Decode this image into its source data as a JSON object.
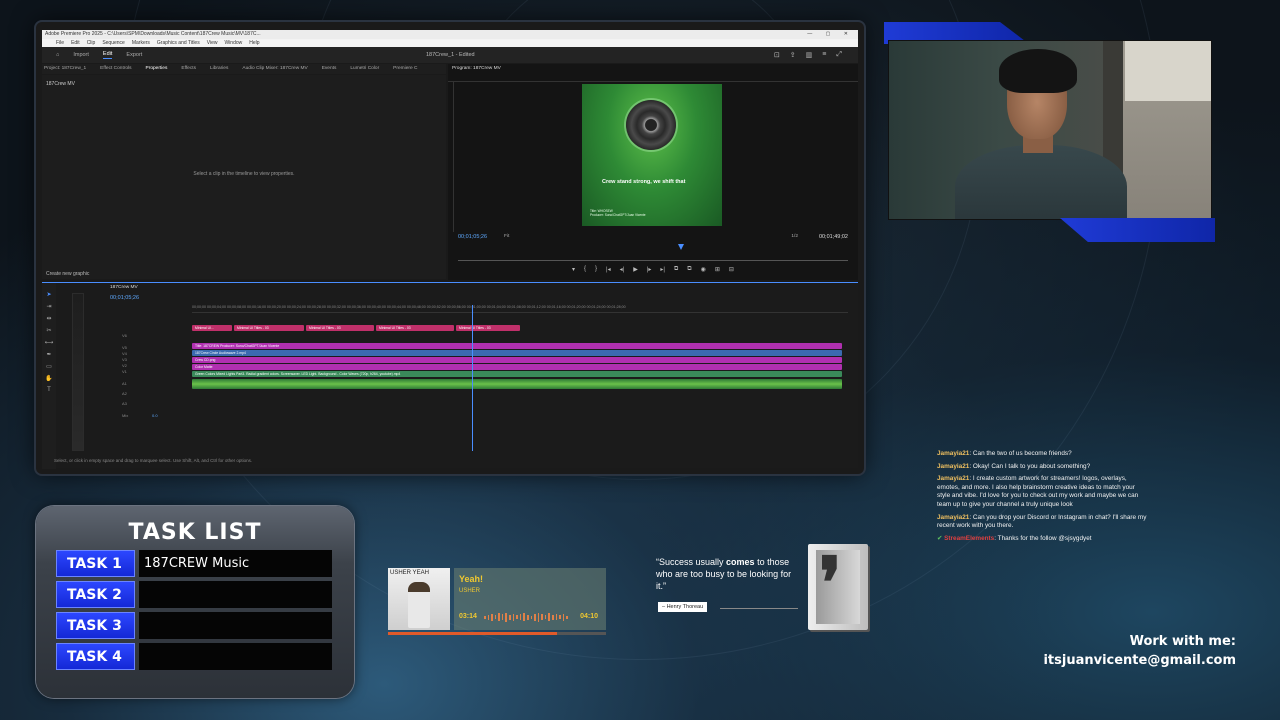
{
  "premiere": {
    "window_title": "Adobe Premiere Pro 2025 - C:\\Users\\SPM\\Downloads\\Music Content\\187Crew Music\\MV\\187C...",
    "window_controls": "— ▢ ✕",
    "menu": [
      "File",
      "Edit",
      "Clip",
      "Sequence",
      "Markers",
      "Graphics and Titles",
      "View",
      "Window",
      "Help"
    ],
    "header_tabs": [
      "Import",
      "Edit",
      "Export"
    ],
    "document_title": "187Crew_1 - Edited",
    "panel_tabs": [
      "Project: 187Crew_1",
      "Effect Controls",
      "Properties",
      "Effects",
      "Libraries",
      "Audio Clip Mixer: 187Crew MV",
      "Events",
      "Lumetri Color",
      "Premiere C"
    ],
    "sequence_name": "187Crew MV",
    "properties_hint": "Select a clip in the timeline to view properties.",
    "create_graphic": "Create new graphic",
    "program_tab": "Program: 187Crew MV",
    "frame_lyric": "Crew stand strong, we shift that",
    "frame_credits_1": "Title: WHOSEW",
    "frame_credits_2": "Producer: Suno/ChatGPT/Juan Vicente",
    "program_timecode": "00;01;05;26",
    "fit": "Fit",
    "quality": "1/2",
    "duration": "00;01;49;02",
    "transport": [
      "▾",
      "{",
      "}",
      "|◂",
      "◂|",
      "▶",
      "|▸",
      "▸|",
      "⧉",
      "⧉",
      "◉",
      "⊞",
      "⊟"
    ],
    "timeline_tab": "187Crew MV",
    "timeline_timecode": "00;01;05;26",
    "ruler_text": "00;00;00 00;00;04;00 00;00;08;00 00;00;16;00 00;00;20;00 00;00;24;00 00;00;28;00 00;00;32;00 00;00;36;00 00;00;40;00 00;00;44;00 00;00;48;00 00;00;52;00 00;00;56;00 00;01;00;00 00;01;04;00 00;01;08;00 00;01;12;00 00;01;16;00 00;01;20;00 00;01;24;00 00;01;28;00",
    "clips": [
      {
        "label": "Minimal UI...",
        "color": "#c0306a"
      },
      {
        "label": "Minimal UI Titles - 03",
        "color": "#c0306a"
      },
      {
        "label": "Minimal UI Titles - 03",
        "color": "#c0306a"
      },
      {
        "label": "Minimal UI Titles - 03",
        "color": "#c0306a"
      },
      {
        "label": "Minimal UI Titles - 03",
        "color": "#c0306a"
      },
      {
        "label": "Title: 187CREW Producer: Suno/ChatGPT/Juan Vicente",
        "color": "#b030b0"
      },
      {
        "label": "187Crew Circle Audiowave 2.mp4",
        "color": "#3a6ab0"
      },
      {
        "label": "Crew CD.png",
        "color": "#b030b0"
      },
      {
        "label": "Color Matte",
        "color": "#b030b0"
      },
      {
        "label": "Green Colors Mixed Lights Part3. Radial gradient colors. Screensaver. LED Light. Background - Color Waves (720p, h264, youtube).mp4",
        "color": "#3a8a5a"
      }
    ],
    "track_labels": [
      "V6",
      "V5",
      "V4",
      "V3",
      "V2",
      "V1",
      "A1",
      "A2",
      "A3",
      "Mix"
    ],
    "mix_value": "0.0",
    "status_text": "Select, or click in empty space and drag to marquee select. Use Shift, Alt, and Ctrl for other options."
  },
  "chat": [
    {
      "user": "Jamayia21",
      "text": "Can the two of us become friends?"
    },
    {
      "user": "Jamayia21",
      "text": "Okay! Can I talk to you about something?"
    },
    {
      "user": "Jamayia21",
      "text": "I create custom artwork for streamers! logos, overlays, emotes, and more. I also help brainstorm creative ideas to match your style and vibe. I'd love for you to check out my work and maybe we can team up to give your channel a truly unique look"
    },
    {
      "user": "Jamayia21",
      "text": "Can you drop your Discord or Instagram in chat? I'll share my recent work with you there."
    },
    {
      "user": "StreamElements",
      "text": "Thanks for the follow @sjsygdyet"
    }
  ],
  "task_list": {
    "title": "TASK LIST",
    "tasks": [
      {
        "label": "TASK 1",
        "value": "187CREW Music"
      },
      {
        "label": "TASK 2",
        "value": ""
      },
      {
        "label": "TASK 3",
        "value": ""
      },
      {
        "label": "TASK 4",
        "value": ""
      }
    ]
  },
  "music": {
    "album_text": "USHER YEAH",
    "title": "Yeah!",
    "artist": "USHER",
    "current_time": "03:14",
    "total_time": "04:10",
    "progress": 0.775
  },
  "quote": {
    "text_lead": "“Success usually ",
    "text_bold": "comes",
    "text_rest": " to those who are too busy to be looking for it.”",
    "author": "– Henry Thoreau",
    "glyph": "❜"
  },
  "contact": {
    "line1": "Work with me:",
    "line2": "itsjuanvicente@gmail.com"
  },
  "colors": {
    "accent_blue": "#1f3bd6",
    "task_label_blue": "#2c47ff",
    "chat_user": "#f0c060",
    "music_yellow": "#f0c830",
    "music_progress": "#e05a2a",
    "premiere_selection": "#4a8eff"
  }
}
